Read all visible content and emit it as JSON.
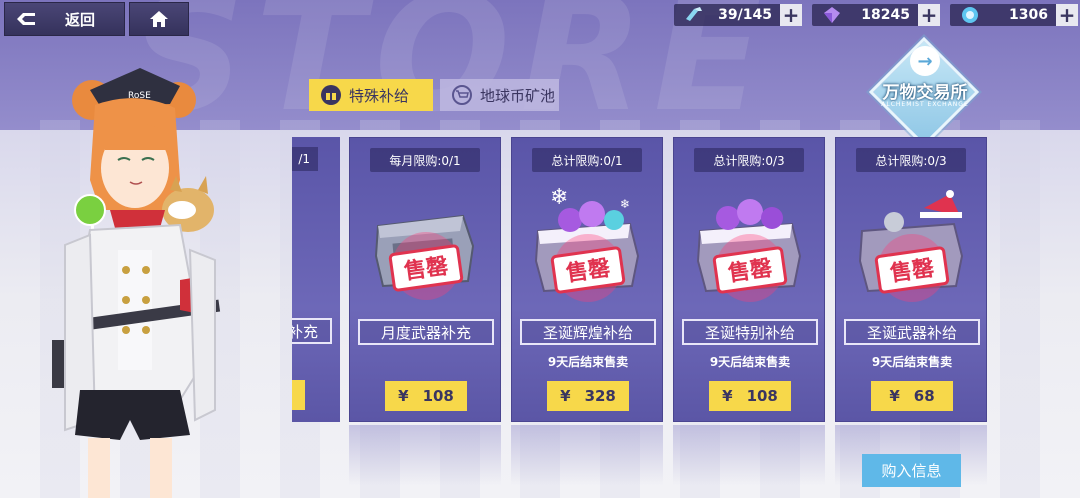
{
  "header": {
    "back_label": "返回",
    "resources": [
      {
        "icon": "stamina-icon",
        "value": "39/145"
      },
      {
        "icon": "crystal-icon",
        "value": "18245"
      },
      {
        "icon": "earth-coin-icon",
        "value": "1306"
      }
    ]
  },
  "exchange": {
    "title": "万物交易所",
    "subtitle": "ALCHEMIST EXCHANGE"
  },
  "tabs": [
    {
      "label": "特殊补给",
      "active": true
    },
    {
      "label": "地球币矿池",
      "active": false
    }
  ],
  "cards": [
    {
      "limit": "每月限购:0/1",
      "name": "月度武器补充",
      "end": "",
      "price": "108",
      "stamp": "售罄"
    },
    {
      "limit": "总计限购:0/1",
      "name": "圣诞辉煌补给",
      "end": "9天后结束售卖",
      "price": "328",
      "stamp": "售罄"
    },
    {
      "limit": "总计限购:0/3",
      "name": "圣诞特别补给",
      "end": "9天后结束售卖",
      "price": "108",
      "stamp": "售罄"
    },
    {
      "limit": "总计限购:0/3",
      "name": "圣诞武器补给",
      "end": "9天后结束售卖",
      "price": "68",
      "stamp": "售罄"
    }
  ],
  "partial_card": {
    "limit_tail": "/1",
    "name_tail": "补充"
  },
  "currency_symbol": "¥",
  "buy_info_label": "购入信息",
  "character": {
    "hat_text": "RoSE"
  },
  "colors": {
    "accent_yellow": "#f7d84a",
    "card_purple": "#5a55a8",
    "info_blue": "#5fb8e8",
    "stamp_red": "#e0334f"
  }
}
